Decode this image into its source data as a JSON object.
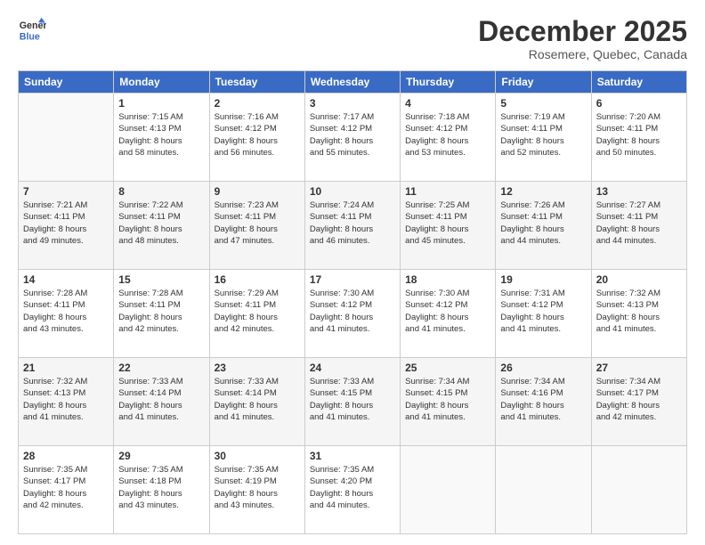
{
  "header": {
    "logo_line1": "General",
    "logo_line2": "Blue",
    "month": "December 2025",
    "location": "Rosemere, Quebec, Canada"
  },
  "weekdays": [
    "Sunday",
    "Monday",
    "Tuesday",
    "Wednesday",
    "Thursday",
    "Friday",
    "Saturday"
  ],
  "weeks": [
    [
      {
        "day": "",
        "info": ""
      },
      {
        "day": "1",
        "info": "Sunrise: 7:15 AM\nSunset: 4:13 PM\nDaylight: 8 hours\nand 58 minutes."
      },
      {
        "day": "2",
        "info": "Sunrise: 7:16 AM\nSunset: 4:12 PM\nDaylight: 8 hours\nand 56 minutes."
      },
      {
        "day": "3",
        "info": "Sunrise: 7:17 AM\nSunset: 4:12 PM\nDaylight: 8 hours\nand 55 minutes."
      },
      {
        "day": "4",
        "info": "Sunrise: 7:18 AM\nSunset: 4:12 PM\nDaylight: 8 hours\nand 53 minutes."
      },
      {
        "day": "5",
        "info": "Sunrise: 7:19 AM\nSunset: 4:11 PM\nDaylight: 8 hours\nand 52 minutes."
      },
      {
        "day": "6",
        "info": "Sunrise: 7:20 AM\nSunset: 4:11 PM\nDaylight: 8 hours\nand 50 minutes."
      }
    ],
    [
      {
        "day": "7",
        "info": "Sunrise: 7:21 AM\nSunset: 4:11 PM\nDaylight: 8 hours\nand 49 minutes."
      },
      {
        "day": "8",
        "info": "Sunrise: 7:22 AM\nSunset: 4:11 PM\nDaylight: 8 hours\nand 48 minutes."
      },
      {
        "day": "9",
        "info": "Sunrise: 7:23 AM\nSunset: 4:11 PM\nDaylight: 8 hours\nand 47 minutes."
      },
      {
        "day": "10",
        "info": "Sunrise: 7:24 AM\nSunset: 4:11 PM\nDaylight: 8 hours\nand 46 minutes."
      },
      {
        "day": "11",
        "info": "Sunrise: 7:25 AM\nSunset: 4:11 PM\nDaylight: 8 hours\nand 45 minutes."
      },
      {
        "day": "12",
        "info": "Sunrise: 7:26 AM\nSunset: 4:11 PM\nDaylight: 8 hours\nand 44 minutes."
      },
      {
        "day": "13",
        "info": "Sunrise: 7:27 AM\nSunset: 4:11 PM\nDaylight: 8 hours\nand 44 minutes."
      }
    ],
    [
      {
        "day": "14",
        "info": "Sunrise: 7:28 AM\nSunset: 4:11 PM\nDaylight: 8 hours\nand 43 minutes."
      },
      {
        "day": "15",
        "info": "Sunrise: 7:28 AM\nSunset: 4:11 PM\nDaylight: 8 hours\nand 42 minutes."
      },
      {
        "day": "16",
        "info": "Sunrise: 7:29 AM\nSunset: 4:11 PM\nDaylight: 8 hours\nand 42 minutes."
      },
      {
        "day": "17",
        "info": "Sunrise: 7:30 AM\nSunset: 4:12 PM\nDaylight: 8 hours\nand 41 minutes."
      },
      {
        "day": "18",
        "info": "Sunrise: 7:30 AM\nSunset: 4:12 PM\nDaylight: 8 hours\nand 41 minutes."
      },
      {
        "day": "19",
        "info": "Sunrise: 7:31 AM\nSunset: 4:12 PM\nDaylight: 8 hours\nand 41 minutes."
      },
      {
        "day": "20",
        "info": "Sunrise: 7:32 AM\nSunset: 4:13 PM\nDaylight: 8 hours\nand 41 minutes."
      }
    ],
    [
      {
        "day": "21",
        "info": "Sunrise: 7:32 AM\nSunset: 4:13 PM\nDaylight: 8 hours\nand 41 minutes."
      },
      {
        "day": "22",
        "info": "Sunrise: 7:33 AM\nSunset: 4:14 PM\nDaylight: 8 hours\nand 41 minutes."
      },
      {
        "day": "23",
        "info": "Sunrise: 7:33 AM\nSunset: 4:14 PM\nDaylight: 8 hours\nand 41 minutes."
      },
      {
        "day": "24",
        "info": "Sunrise: 7:33 AM\nSunset: 4:15 PM\nDaylight: 8 hours\nand 41 minutes."
      },
      {
        "day": "25",
        "info": "Sunrise: 7:34 AM\nSunset: 4:15 PM\nDaylight: 8 hours\nand 41 minutes."
      },
      {
        "day": "26",
        "info": "Sunrise: 7:34 AM\nSunset: 4:16 PM\nDaylight: 8 hours\nand 41 minutes."
      },
      {
        "day": "27",
        "info": "Sunrise: 7:34 AM\nSunset: 4:17 PM\nDaylight: 8 hours\nand 42 minutes."
      }
    ],
    [
      {
        "day": "28",
        "info": "Sunrise: 7:35 AM\nSunset: 4:17 PM\nDaylight: 8 hours\nand 42 minutes."
      },
      {
        "day": "29",
        "info": "Sunrise: 7:35 AM\nSunset: 4:18 PM\nDaylight: 8 hours\nand 43 minutes."
      },
      {
        "day": "30",
        "info": "Sunrise: 7:35 AM\nSunset: 4:19 PM\nDaylight: 8 hours\nand 43 minutes."
      },
      {
        "day": "31",
        "info": "Sunrise: 7:35 AM\nSunset: 4:20 PM\nDaylight: 8 hours\nand 44 minutes."
      },
      {
        "day": "",
        "info": ""
      },
      {
        "day": "",
        "info": ""
      },
      {
        "day": "",
        "info": ""
      }
    ]
  ]
}
